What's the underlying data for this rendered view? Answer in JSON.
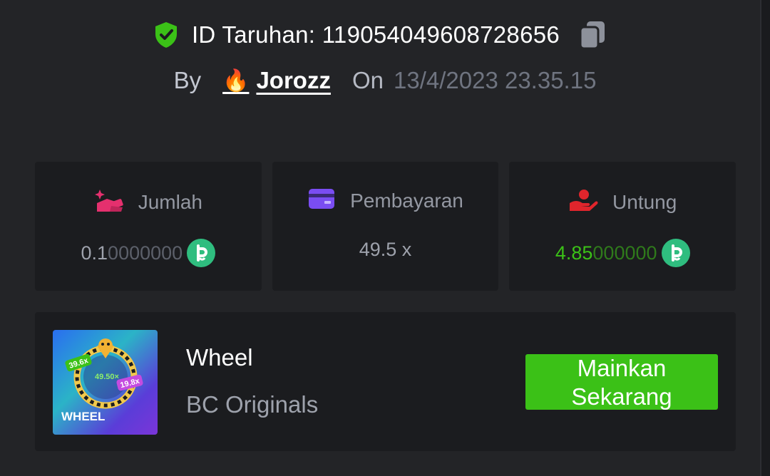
{
  "header": {
    "bet_id_label": "ID Taruhan: 119054049608728656",
    "by_label": "By",
    "username": "Jorozz",
    "on_label": "On",
    "timestamp": "13/4/2023 23.35.15"
  },
  "stats": {
    "amount": {
      "label": "Jumlah",
      "value_main": "0.1",
      "value_dim": "0000000"
    },
    "payout": {
      "label": "Pembayaran",
      "value": "49.5 x"
    },
    "profit": {
      "label": "Untung",
      "value_main": "4.85",
      "value_dim": "000000"
    }
  },
  "game": {
    "title": "Wheel",
    "provider": "BC Originals",
    "play_button": "Mainkan Sekarang",
    "thumb": {
      "label": "WHEEL",
      "mult_center": "49.50×",
      "mult_left": "39.6x",
      "mult_right": "19.8x"
    }
  },
  "colors": {
    "background": "#232427",
    "card": "#1b1c1f",
    "accent_green": "#3bc117",
    "shield_green": "#3bc117",
    "pink": "#e5306e",
    "purple": "#7a4df2",
    "red": "#e0252c"
  },
  "icons": {
    "verified": "shield-check-icon",
    "copy": "copy-icon",
    "user_badge": "fire-icon",
    "amount": "bet-amount-icon",
    "payout": "wallet-card-icon",
    "profit": "hand-coin-icon",
    "currency": "bc-coin-icon"
  }
}
